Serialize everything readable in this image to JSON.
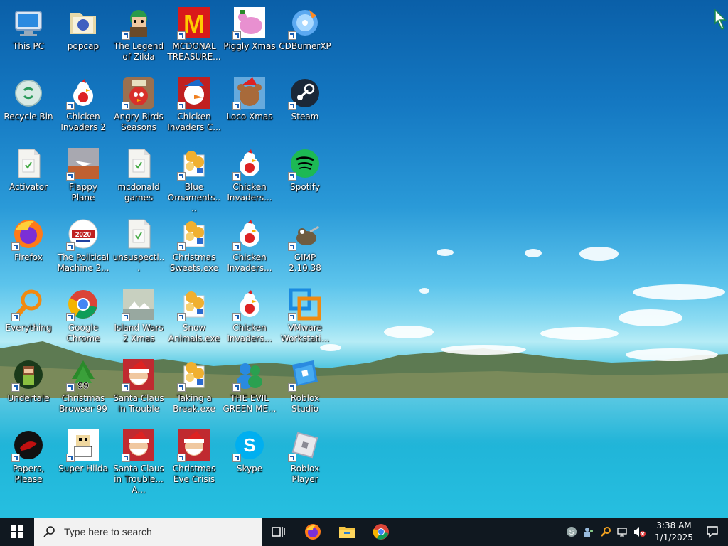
{
  "desktop": {
    "icons": [
      {
        "label": "This PC",
        "icon": "computer-icon"
      },
      {
        "label": "popcap",
        "icon": "folder-icon"
      },
      {
        "label": "The Legend of Zilda",
        "icon": "game-character-icon"
      },
      {
        "label": "MCDONAL TREASURE...",
        "icon": "mcdonalds-logo-icon"
      },
      {
        "label": "Piggly Xmas",
        "icon": "pig-icon"
      },
      {
        "label": "CDBurnerXP",
        "icon": "disc-icon"
      },
      {
        "label": "Recycle Bin",
        "icon": "recycle-bin-icon"
      },
      {
        "label": "Chicken Invaders 2",
        "icon": "chicken-icon"
      },
      {
        "label": "Angry Birds Seasons",
        "icon": "angry-bird-icon"
      },
      {
        "label": "Chicken Invaders C...",
        "icon": "snowman-chicken-icon"
      },
      {
        "label": "Loco Xmas",
        "icon": "bear-icon"
      },
      {
        "label": "Steam",
        "icon": "steam-icon"
      },
      {
        "label": "Activator",
        "icon": "file-icon"
      },
      {
        "label": "Flappy Plane",
        "icon": "plane-game-icon"
      },
      {
        "label": "mcdonald games",
        "icon": "file-icon"
      },
      {
        "label": "Blue Ornaments....",
        "icon": "exe-icon"
      },
      {
        "label": "Chicken Invaders...",
        "icon": "chicken-icon"
      },
      {
        "label": "Spotify",
        "icon": "spotify-icon"
      },
      {
        "label": "Firefox",
        "icon": "firefox-icon"
      },
      {
        "label": "The Political Machine 2...",
        "icon": "political-badge-icon"
      },
      {
        "label": "unsuspecti...",
        "icon": "file-icon"
      },
      {
        "label": "Christmas Sweets.exe",
        "icon": "exe-icon"
      },
      {
        "label": "Chicken Invaders...",
        "icon": "chicken-icon"
      },
      {
        "label": "GIMP 2.10.38",
        "icon": "gimp-icon"
      },
      {
        "label": "Everything",
        "icon": "search-magnifier-icon"
      },
      {
        "label": "Google Chrome",
        "icon": "chrome-icon"
      },
      {
        "label": "Island Wars 2 Xmas",
        "icon": "island-icon"
      },
      {
        "label": "Snow Animals.exe",
        "icon": "exe-icon"
      },
      {
        "label": "Chicken Invaders...",
        "icon": "chicken-icon"
      },
      {
        "label": "VMware Workstati...",
        "icon": "vmware-icon"
      },
      {
        "label": "Undertale",
        "icon": "undertale-icon"
      },
      {
        "label": "Christmas Browser 99",
        "icon": "christmas-tree-icon"
      },
      {
        "label": "Santa Claus in Trouble",
        "icon": "santa-icon"
      },
      {
        "label": "Taking a Break.exe",
        "icon": "exe-icon"
      },
      {
        "label": "THE EVIL GREEN ME...",
        "icon": "messenger-icon"
      },
      {
        "label": "Roblox Studio",
        "icon": "roblox-studio-icon"
      },
      {
        "label": "Papers, Please",
        "icon": "papers-please-icon"
      },
      {
        "label": "Super Hilda",
        "icon": "pixel-character-icon"
      },
      {
        "label": "Santa Claus in Trouble... A...",
        "icon": "santa-icon"
      },
      {
        "label": "Christmas Eve Crisis",
        "icon": "santa-icon"
      },
      {
        "label": "Skype",
        "icon": "skype-icon"
      },
      {
        "label": "Roblox Player",
        "icon": "roblox-icon"
      }
    ]
  },
  "taskbar": {
    "search_placeholder": "Type here to search",
    "clock_time": "3:38 AM",
    "clock_date": "1/1/2025",
    "pinned": [
      "task-view-icon",
      "firefox-icon",
      "file-explorer-icon",
      "chrome-icon"
    ]
  },
  "colors": {
    "taskbar_bg": "#101820",
    "search_bg": "#f2f2f2",
    "windows_blue": "#2b8cff"
  }
}
